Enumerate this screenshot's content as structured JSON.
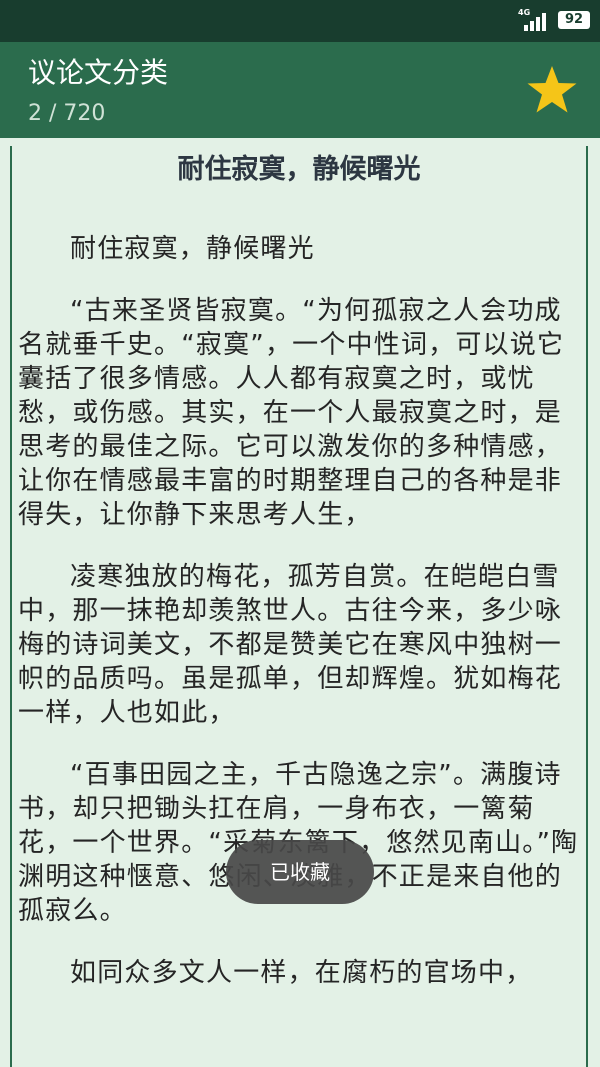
{
  "status_bar": {
    "network": "4G",
    "battery": "92"
  },
  "header": {
    "title": "议论文分类",
    "counter": "2 / 720",
    "favorite_icon": "star-icon",
    "accent_color": "#f5c518"
  },
  "article": {
    "title": "耐住寂寞，静候曙光",
    "paragraphs": [
      "耐住寂寞，静候曙光",
      "“古来圣贤皆寂寞。“为何孤寂之人会功成名就垂千史。“寂寞”，一个中性词，可以说它囊括了很多情感。人人都有寂寞之时，或忧愁，或伤感。其实，在一个人最寂寞之时，是思考的最佳之际。它可以激发你的多种情感，让你在情感最丰富的时期整理自己的各种是非得失，让你静下来思考人生，",
      "凌寒独放的梅花，孤芳自赏。在皑皑白雪中，那一抹艳却羡煞世人。古往今来，多少咏梅的诗词美文，不都是赞美它在寒风中独树一帜的品质吗。虽是孤单，但却辉煌。犹如梅花一样，人也如此，",
      "“百事田园之主，千古隐逸之宗”。满腹诗书，却只把锄头扛在肩，一身布衣，一篱菊花，一个世界。“采菊东篱下，悠然见南山。”陶渊明这种惬意、悠闲、淡雅，不正是来自他的孤寂么。",
      "如同众多文人一样，在腐朽的官场中，"
    ]
  },
  "toast": {
    "text": "已收藏"
  }
}
